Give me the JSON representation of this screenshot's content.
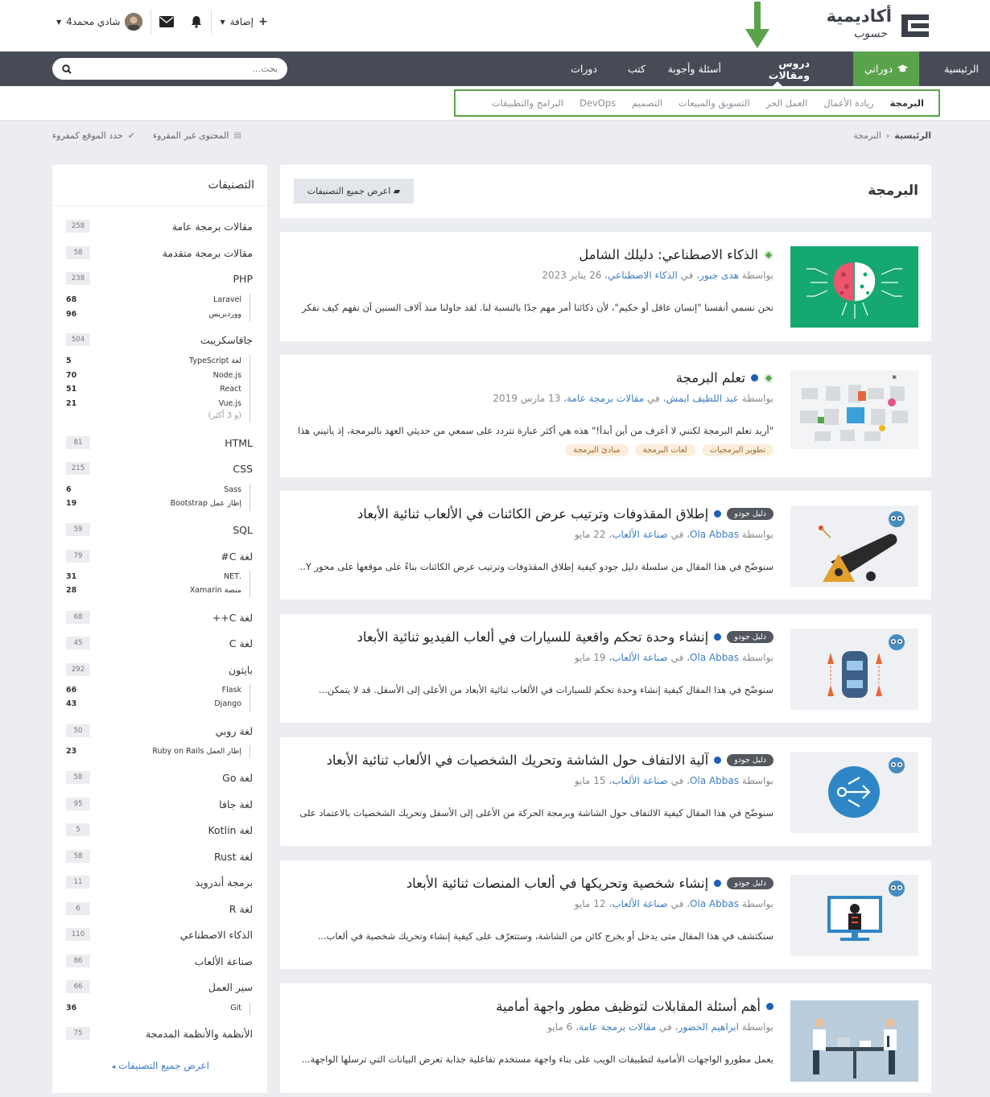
{
  "header": {
    "logo_text": "أكاديمية",
    "logo_sub": "حسوب",
    "add_label": "إضافة",
    "user_name": "شادي محمد4"
  },
  "nav": {
    "items": [
      {
        "label": "الرئيسية"
      },
      {
        "label": "دوراتي"
      },
      {
        "label": "دروس ومقالات"
      },
      {
        "label": "أسئلة وأجوبة"
      },
      {
        "label": "كتب"
      },
      {
        "label": "دورات"
      }
    ],
    "search_placeholder": "بحث..."
  },
  "subnav": {
    "items": [
      {
        "label": "البرمجة"
      },
      {
        "label": "ريادة الأعمال"
      },
      {
        "label": "العمل الحر"
      },
      {
        "label": "التسويق والمبيعات"
      },
      {
        "label": "التصميم"
      },
      {
        "label": "DevOps"
      },
      {
        "label": "البرامج والتطبيقات"
      }
    ]
  },
  "breadcrumb": {
    "home": "الرئيسية",
    "current": "البرمجة"
  },
  "tools": {
    "unread": "المحتوى غير المقروء",
    "mark_read": "حدد الموقع كمقروء"
  },
  "section": {
    "title": "البرمجة",
    "all_categories_btn": "اعرض جميع التصنيفات"
  },
  "articles": [
    {
      "title": "الذكاء الاصطناعي: دليلك الشامل",
      "by": "بواسطة",
      "author": "هدى جبور",
      "in": "، في",
      "category": "الذكاء الاصطناعي",
      "date": "، 26 يناير 2023",
      "excerpt": "نحن نسمي أنفسنا \"إنسان عاقل أو حكيم\"، لأن ذكائنا أمر مهم جدًا بالنسبة لنا. لقد حاولنا منذ آلاف السنين أن نفهم كيف نفكر أي...",
      "badge": "",
      "tags": []
    },
    {
      "title": "تعلم البرمجة",
      "by": "بواسطة",
      "author": "عبد اللطيف ايمش",
      "in": "، في",
      "category": "مقالات برمجة عامة",
      "date": "، 13 مارس 2019",
      "excerpt": "\"أريد تعلم البرمجة لكنني لا أعرف من أين أبدأ!\" هذه هي أكثر عبارة تتردد على سمعي من حديثي العهد بالبرمجة، إذ يأتيني هذا...",
      "badge": "",
      "tags": [
        "تطوير البرمجيات",
        "لغات البرمجة",
        "مبادئ البرمجة"
      ]
    },
    {
      "title": "إطلاق المقذوفات وترتيب عرض الكائنات في الألعاب ثنائية الأبعاد",
      "by": "بواسطة",
      "author": "Ola Abbas",
      "in": "، في",
      "category": "صناعة الألعاب",
      "date": "، 22 مايو",
      "excerpt": "سنوضّح في هذا المقال من سلسلة دليل جودو كيفية إطلاق المقذوفات وترتيب عرض الكائنات بناءً على موقعها على محور Y...",
      "badge": "دليل جودو",
      "tags": []
    },
    {
      "title": "إنشاء وحدة تحكم واقعية للسيارات في ألعاب الفيديو ثنائية الأبعاد",
      "by": "بواسطة",
      "author": "Ola Abbas",
      "in": "، في",
      "category": "صناعة الألعاب",
      "date": "، 19 مايو",
      "excerpt": "سنوضّح في هذا المقال كيفية إنشاء وحدة تحكم للسيارات في الألعاب ثنائية الأبعاد من الأعلى إلى الأسفل. قد لا يتمكن...",
      "badge": "دليل جودو",
      "tags": []
    },
    {
      "title": "آلية الالتفاف حول الشاشة وتحريك الشخصيات في الألعاب ثنائية الأبعاد",
      "by": "بواسطة",
      "author": "Ola Abbas",
      "in": "، في",
      "category": "صناعة الألعاب",
      "date": "، 15 مايو",
      "excerpt": "سنوضّح في هذا المقال كيفية الالتفاف حول الشاشة وبرمجة الحركة من الأعلى إلى الأسفل وتحريك الشخصيات بالاعتماد على...",
      "badge": "دليل جودو",
      "tags": []
    },
    {
      "title": "إنشاء شخصية وتحريكها في ألعاب المنصات ثنائية الأبعاد",
      "by": "بواسطة",
      "author": "Ola Abbas",
      "in": "، في",
      "category": "صناعة الألعاب",
      "date": "، 12 مايو",
      "excerpt": "سنكتشف في هذا المقال متى يدخل أو يخرج كائن من الشاشة، وستتعرّف على كيفية إنشاء وتحريك شخصية في ألعاب...",
      "badge": "دليل جودو",
      "tags": []
    },
    {
      "title": "أهم أسئلة المقابلات لتوظيف مطور واجهة أمامية",
      "by": "بواسطة",
      "author": "ابراهيم الخضور",
      "in": "، في",
      "category": "مقالات برمجة عامة",
      "date": "، 6 مايو",
      "excerpt": "يعمل مطورو الواجهات الأمامية لتطبيقات الويب على بناء واجهة مستخدم تفاعلية جذابة تعرض البيانات التي ترسلها الواجهة...",
      "badge": "",
      "tags": []
    }
  ],
  "sidebar": {
    "title": "التصنيفات",
    "more": "اعرض جميع التصنيفات",
    "cats": [
      {
        "name": "مقالات برمجة عامة",
        "count": "258"
      },
      {
        "name": "مقالات برمجة متقدمة",
        "count": "58"
      },
      {
        "name": "PHP",
        "count": "238"
      },
      {
        "name": "جافاسكريبت",
        "count": "504"
      },
      {
        "name": "HTML",
        "count": "81"
      },
      {
        "name": "CSS",
        "count": "215"
      },
      {
        "name": "SQL",
        "count": "59"
      },
      {
        "name": "لغة C#",
        "count": "79"
      },
      {
        "name": "لغة C++",
        "count": "68"
      },
      {
        "name": "لغة C",
        "count": "45"
      },
      {
        "name": "بايثون",
        "count": "292"
      },
      {
        "name": "لغة روبي",
        "count": "50"
      },
      {
        "name": "لغة Go",
        "count": "58"
      },
      {
        "name": "لغة جافا",
        "count": "95"
      },
      {
        "name": "لغة Kotlin",
        "count": "5"
      },
      {
        "name": "لغة Rust",
        "count": "58"
      },
      {
        "name": "برمجة أندرويد",
        "count": "11"
      },
      {
        "name": "لغة R",
        "count": "6"
      },
      {
        "name": "الذكاء الاصطناعي",
        "count": "110"
      },
      {
        "name": "صناعة الألعاب",
        "count": "86"
      },
      {
        "name": "سير العمل",
        "count": "66"
      },
      {
        "name": "الأنظمة والأنظمة المدمجة",
        "count": "75"
      }
    ],
    "subs": {
      "php": [
        {
          "name": "Laravel",
          "count": "68"
        },
        {
          "name": "ووردبريس",
          "count": "96"
        }
      ],
      "js": [
        {
          "name": "لغة TypeScript",
          "count": "5"
        },
        {
          "name": "Node.js",
          "count": "70"
        },
        {
          "name": "React",
          "count": "51"
        },
        {
          "name": "Vue.js",
          "count": "21"
        }
      ],
      "js_more": "(و 3 أكثر)",
      "css": [
        {
          "name": "Sass",
          "count": "6"
        },
        {
          "name": "إطار عمل Bootstrap",
          "count": "19"
        }
      ],
      "cs": [
        {
          "name": ".NET",
          "count": "31"
        },
        {
          "name": "منصة Xamarin",
          "count": "28"
        }
      ],
      "py": [
        {
          "name": "Flask",
          "count": "66"
        },
        {
          "name": "Django",
          "count": "43"
        }
      ],
      "ruby": [
        {
          "name": "إطار العمل Ruby on Rails",
          "count": "23"
        }
      ],
      "workflow": [
        {
          "name": "Git",
          "count": "36"
        }
      ]
    }
  },
  "colors": {
    "nav_bg": "#464b55",
    "accent_green": "#5aa34a",
    "link_blue": "#3b7dc5"
  }
}
